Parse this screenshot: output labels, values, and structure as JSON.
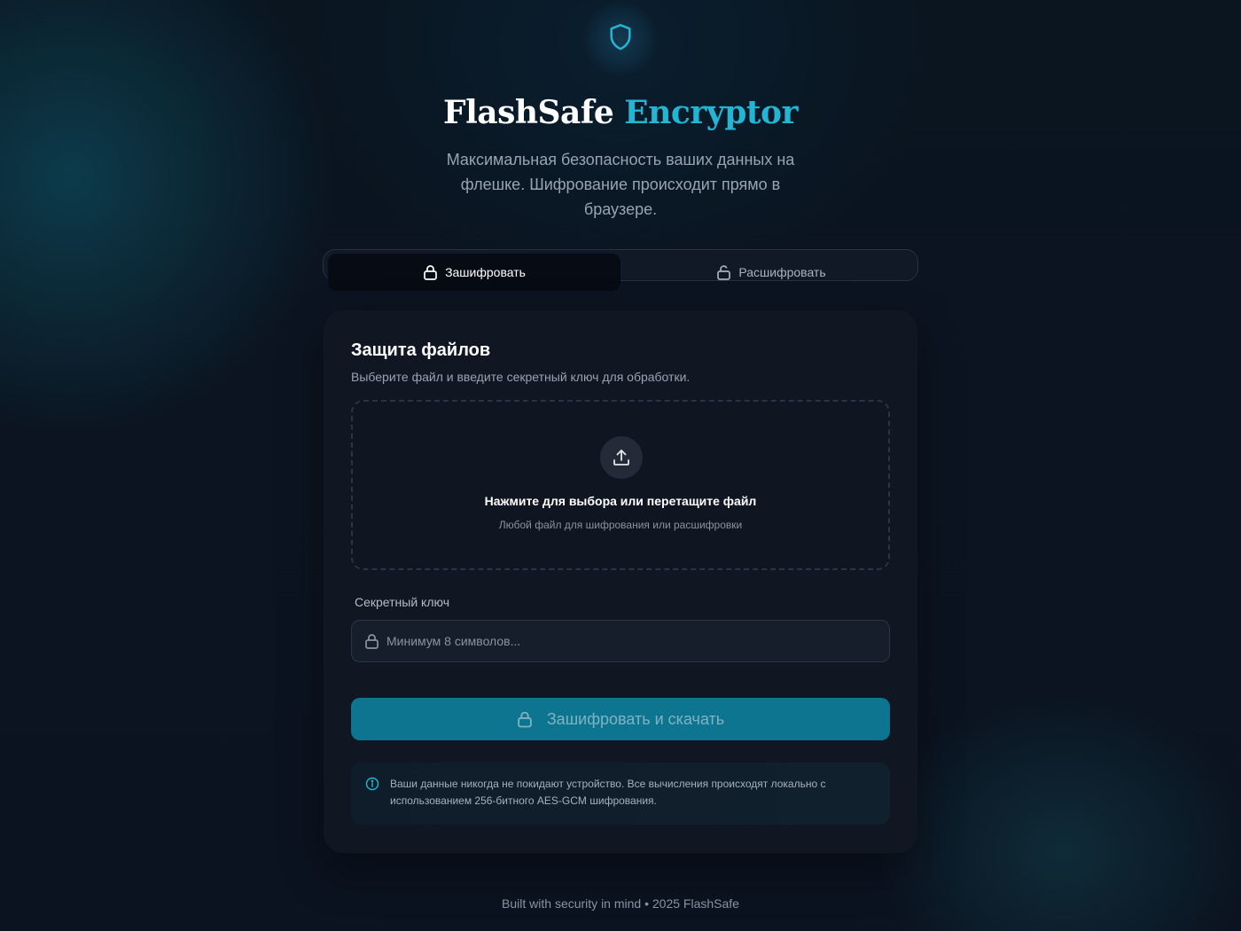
{
  "header": {
    "logo_icon": "shield-icon",
    "title_main": "FlashSafe",
    "title_accent": "Encryptor",
    "subtitle": "Максимальная безопасность ваших данных на флешке. Шифрование происходит прямо в браузере."
  },
  "tabs": [
    {
      "label": "Зашифровать",
      "icon": "lock-icon",
      "active": true
    },
    {
      "label": "Расшифровать",
      "icon": "unlock-icon",
      "active": false
    }
  ],
  "card": {
    "title": "Защита файлов",
    "subtitle": "Выберите файл и введите секретный ключ для обработки.",
    "dropzone": {
      "icon": "upload-icon",
      "main_text": "Нажмите для выбора или перетащите файл",
      "sub_text": "Любой файл для шифрования или расшифровки"
    },
    "key": {
      "label": "Секретный ключ",
      "placeholder": "Минимум 8 символов...",
      "value": ""
    },
    "submit_label": "Зашифровать и скачать",
    "info_text": "Ваши данные никогда не покидают устройство. Все вычисления происходят локально с использованием 256-битного AES-GCM шифрования."
  },
  "footer": "Built with security in mind • 2025 FlashSafe",
  "colors": {
    "accent": "#22b5d4",
    "button": "#0e7590",
    "background": "#0b1420",
    "card": "#101723"
  }
}
